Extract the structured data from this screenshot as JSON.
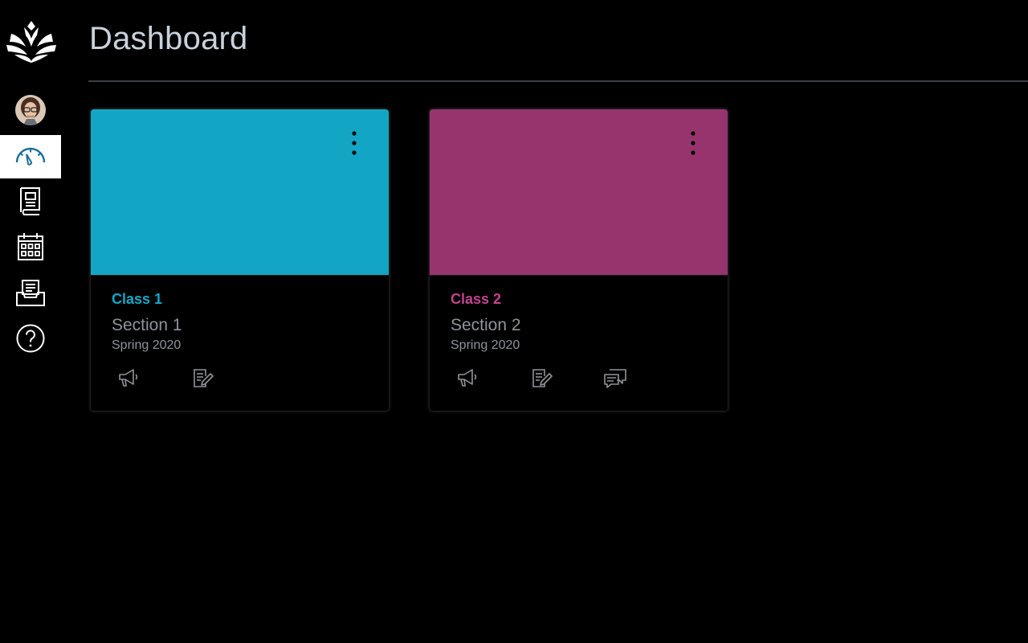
{
  "header": {
    "title": "Dashboard"
  },
  "sidebar": {
    "logo": "canvas-logo-icon",
    "avatar": "user-avatar",
    "items": [
      {
        "name": "dashboard",
        "icon": "dashboard-gauge-icon",
        "active": true
      },
      {
        "name": "courses",
        "icon": "book-icon",
        "active": false
      },
      {
        "name": "calendar",
        "icon": "calendar-icon",
        "active": false
      },
      {
        "name": "inbox",
        "icon": "inbox-icon",
        "active": false
      },
      {
        "name": "help",
        "icon": "help-circle-icon",
        "active": false
      }
    ]
  },
  "cards": [
    {
      "title": "Class 1",
      "section": "Section 1",
      "term": "Spring 2020",
      "color": "#13a6c4",
      "actions": [
        "announcements-icon",
        "assignments-icon"
      ]
    },
    {
      "title": "Class 2",
      "section": "Section 2",
      "term": "Spring 2020",
      "color": "#97346e",
      "actions": [
        "announcements-icon",
        "assignments-icon",
        "discussions-icon"
      ]
    }
  ],
  "colors": {
    "background": "#000000",
    "active_nav_bg": "#ffffff",
    "active_nav_icon": "#1a6f99",
    "card1_title": "#14a7c8",
    "card2_title": "#c2438f"
  }
}
